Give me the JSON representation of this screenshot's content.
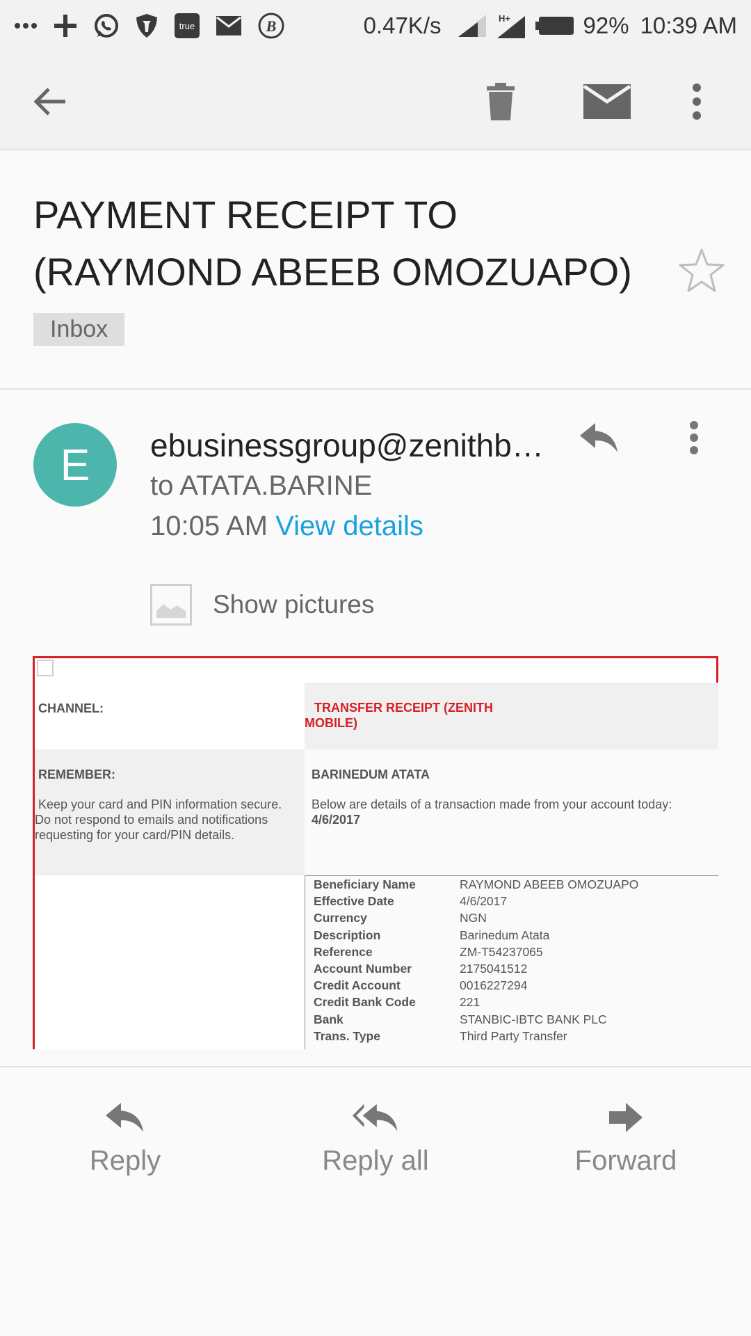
{
  "status_bar": {
    "net_speed": "0.47K/s",
    "battery_percent": "92%",
    "time": "10:39 AM",
    "icons": [
      "more-dots-icon",
      "plus-icon",
      "whatsapp-icon",
      "shield-icon",
      "true-icon",
      "mail-icon",
      "b-badge-icon",
      "signal-icon",
      "signal-h-plus-icon",
      "battery-icon"
    ],
    "true_badge": "true",
    "b_badge": "B"
  },
  "app_bar": {
    "icons": [
      "back-arrow-icon",
      "trash-icon",
      "mail-envelope-icon",
      "more-vert-icon"
    ]
  },
  "email": {
    "subject": "PAYMENT RECEIPT TO (RAYMOND ABEEB OMOZUAPO)",
    "label": "Inbox",
    "avatar_letter": "E",
    "avatar_color": "#4db6ac",
    "sender": "ebusinessgroup@zenithb…",
    "to_line": "to ATATA.BARINE",
    "time": "10:05 AM",
    "view_details": "View details",
    "show_pictures": "Show pictures"
  },
  "receipt": {
    "channel_label": "CHANNEL:",
    "channel_value": "TRANSFER RECEIPT (ZENITH MOBILE)",
    "remember_label": "REMEMBER:",
    "remember_text": "Keep your card and PIN information secure. Do not respond to emails and notifications requesting for your  card/PIN details.",
    "customer_name": "BARINEDUM ATATA",
    "intro_text": "Below are details of a transaction made from your account today: ",
    "intro_date": "4/6/2017",
    "border_color": "#d61f26",
    "details": [
      {
        "key": "Beneficiary Name",
        "value": "RAYMOND ABEEB OMOZUAPO"
      },
      {
        "key": "Effective Date",
        "value": "4/6/2017"
      },
      {
        "key": "Currency",
        "value": "NGN"
      },
      {
        "key": "Description",
        "value": "Barinedum Atata"
      },
      {
        "key": "Reference",
        "value": "ZM-T54237065"
      },
      {
        "key": "Account Number",
        "value": "2175041512"
      },
      {
        "key": "Credit Account",
        "value": "0016227294"
      },
      {
        "key": "Credit Bank Code",
        "value": "221"
      },
      {
        "key": "Bank",
        "value": "STANBIC-IBTC BANK PLC"
      },
      {
        "key": "Trans. Type",
        "value": "Third Party Transfer"
      }
    ]
  },
  "actions": {
    "reply": "Reply",
    "reply_all": "Reply all",
    "forward": "Forward"
  }
}
